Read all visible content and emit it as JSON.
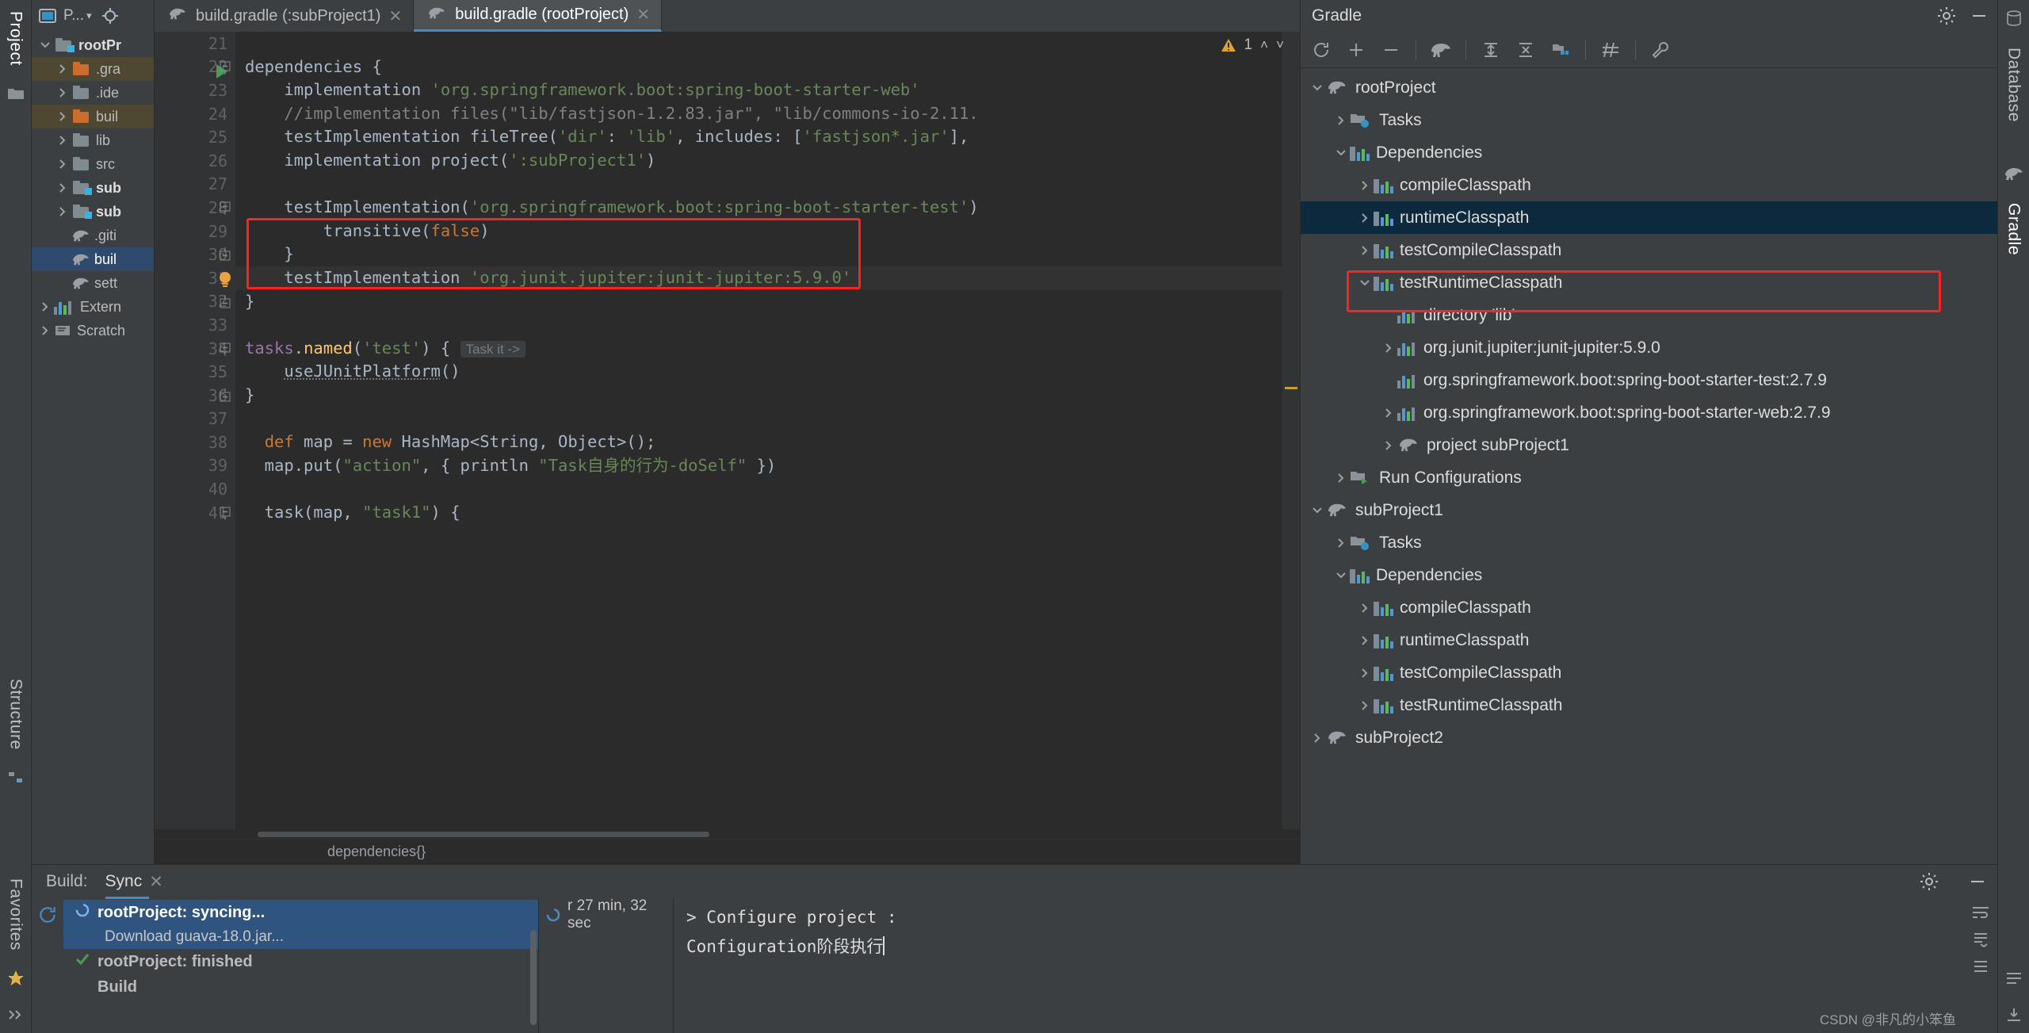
{
  "left_strip": {
    "project_tab": "Project",
    "structure_tab": "Structure",
    "favorites_tab": "Favorites",
    "folder_icon": "folder-icon",
    "star_icon": "star-icon",
    "expand_icon": "expand-chevrons-icon"
  },
  "right_strip": {
    "database_tab": "Database",
    "gradle_tab": "Gradle",
    "build_icon": "build-icon",
    "download_icon": "download-icon"
  },
  "project_panel": {
    "title": "P...",
    "dropdown_icon": "chevron-down-icon",
    "locate_icon": "target-icon",
    "items": [
      {
        "label": "rootPr",
        "depth": 0,
        "arrow": "chevron-down",
        "icon": "module-folder-icon",
        "bold": true,
        "state": "normal"
      },
      {
        "label": ".gra",
        "depth": 1,
        "arrow": "chevron-right",
        "icon": "excluded-folder-icon",
        "bold": false,
        "state": "excluded"
      },
      {
        "label": ".ide",
        "depth": 1,
        "arrow": "chevron-right",
        "icon": "folder-icon",
        "bold": false,
        "state": "normal"
      },
      {
        "label": "buil",
        "depth": 1,
        "arrow": "chevron-right",
        "icon": "excluded-folder-icon",
        "bold": false,
        "state": "excluded"
      },
      {
        "label": "lib",
        "depth": 1,
        "arrow": "chevron-right",
        "icon": "folder-icon",
        "bold": false,
        "state": "normal"
      },
      {
        "label": "src",
        "depth": 1,
        "arrow": "chevron-right",
        "icon": "folder-icon",
        "bold": false,
        "state": "normal"
      },
      {
        "label": "sub",
        "depth": 1,
        "arrow": "chevron-right",
        "icon": "module-folder-icon",
        "bold": true,
        "state": "normal"
      },
      {
        "label": "sub",
        "depth": 1,
        "arrow": "chevron-right",
        "icon": "module-folder-icon",
        "bold": true,
        "state": "normal"
      },
      {
        "label": ".giti",
        "depth": 1,
        "arrow": "none",
        "icon": "gradle-file-icon",
        "bold": false,
        "state": "normal"
      },
      {
        "label": "buil",
        "depth": 1,
        "arrow": "none",
        "icon": "gradle-file-icon",
        "bold": false,
        "state": "selected"
      },
      {
        "label": "sett",
        "depth": 1,
        "arrow": "none",
        "icon": "gradle-file-icon",
        "bold": false,
        "state": "normal"
      },
      {
        "label": "Extern",
        "depth": 0,
        "arrow": "chevron-right",
        "icon": "library-icon",
        "bold": false,
        "state": "normal"
      },
      {
        "label": "Scratch",
        "depth": 0,
        "arrow": "chevron-right",
        "icon": "scratch-icon",
        "bold": false,
        "state": "normal"
      }
    ]
  },
  "editor": {
    "tabs": [
      {
        "label": "build.gradle (:subProject1)",
        "icon": "gradle-elephant-icon",
        "active": false,
        "close_icon": "close-icon"
      },
      {
        "label": "build.gradle (rootProject)",
        "icon": "gradle-elephant-icon",
        "active": true,
        "close_icon": "close-icon"
      }
    ],
    "warning_count": "1",
    "warning_icon": "warning-triangle-icon",
    "prev_icon": "chevron-up-icon",
    "next_icon": "chevron-down-icon",
    "breadcrumb": "dependencies{}",
    "first_line_number": 21,
    "lines": [
      {
        "n": 21,
        "text": ""
      },
      {
        "n": 22,
        "text": "dependencies {",
        "run_marker": true,
        "fold": "minus"
      },
      {
        "n": 23,
        "text": "    implementation 'org.springframework.boot:spring-boot-starter-web'"
      },
      {
        "n": 24,
        "text": "    //implementation files(\"lib/fastjson-1.2.83.jar\", \"lib/commons-io-2.11."
      },
      {
        "n": 25,
        "text": "    testImplementation fileTree('dir': 'lib', includes: ['fastjson*.jar'],"
      },
      {
        "n": 26,
        "text": "    implementation project(':subProject1')"
      },
      {
        "n": 27,
        "text": ""
      },
      {
        "n": 28,
        "text": "    testImplementation('org.springframework.boot:spring-boot-starter-test')",
        "fold": "minus"
      },
      {
        "n": 29,
        "text": "        transitive(false)"
      },
      {
        "n": 30,
        "text": "    }",
        "fold": "end"
      },
      {
        "n": 31,
        "text": "    testImplementation 'org.junit.jupiter:junit-jupiter:5.9.0'",
        "bulb": true,
        "current": true
      },
      {
        "n": 32,
        "text": "}",
        "fold": "end"
      },
      {
        "n": 33,
        "text": ""
      },
      {
        "n": 34,
        "text": "tasks.named('test') { Task it ->",
        "fold": "minus",
        "hint": "Task it ->"
      },
      {
        "n": 35,
        "text": "    useJUnitPlatform()"
      },
      {
        "n": 36,
        "text": "}",
        "fold": "end"
      },
      {
        "n": 37,
        "text": ""
      },
      {
        "n": 38,
        "text": "  def map = new HashMap<String, Object>();"
      },
      {
        "n": 39,
        "text": "  map.put(\"action\", { println \"Task自身的行为-doSelf\" })"
      },
      {
        "n": 40,
        "text": ""
      },
      {
        "n": 41,
        "text": "  task(map, \"task1\") {",
        "fold": "minus"
      }
    ]
  },
  "gradle_panel": {
    "title": "Gradle",
    "settings_icon": "gear-icon",
    "minimize_icon": "minimize-icon",
    "toolbar": [
      {
        "name": "refresh-icon",
        "label": "Reload All Gradle Projects"
      },
      {
        "name": "plus-icon",
        "label": "Link Gradle Project"
      },
      {
        "name": "minus-icon",
        "label": "Detach External Project"
      },
      {
        "name": "elephant-icon",
        "label": "Execute Gradle Task"
      },
      {
        "name": "expand-all-icon",
        "label": "Expand All"
      },
      {
        "name": "collapse-all-icon",
        "label": "Collapse All"
      },
      {
        "name": "module-icon",
        "label": "Show Modules"
      },
      {
        "name": "skip-tests-icon",
        "label": "Toggle Offline Mode"
      },
      {
        "name": "wrench-icon",
        "label": "Build Tool Settings"
      }
    ],
    "tree": [
      {
        "label": "rootProject",
        "depth": 0,
        "arrow": "chevron-down",
        "icon": "elephant-icon"
      },
      {
        "label": "Tasks",
        "depth": 1,
        "arrow": "chevron-right",
        "icon": "tasks-icon"
      },
      {
        "label": "Dependencies",
        "depth": 1,
        "arrow": "chevron-down",
        "icon": "dependencies-icon"
      },
      {
        "label": "compileClasspath",
        "depth": 2,
        "arrow": "chevron-right",
        "icon": "dependencies-icon"
      },
      {
        "label": "runtimeClasspath",
        "depth": 2,
        "arrow": "chevron-right",
        "icon": "dependencies-icon",
        "selected": true
      },
      {
        "label": "testCompileClasspath",
        "depth": 2,
        "arrow": "chevron-right",
        "icon": "dependencies-icon"
      },
      {
        "label": "testRuntimeClasspath",
        "depth": 2,
        "arrow": "chevron-down",
        "icon": "dependencies-icon"
      },
      {
        "label": "directory 'lib'",
        "depth": 3,
        "arrow": "none",
        "icon": "library-bars-icon"
      },
      {
        "label": "org.junit.jupiter:junit-jupiter:5.9.0",
        "depth": 3,
        "arrow": "chevron-right",
        "icon": "library-bars-icon",
        "highlight": true
      },
      {
        "label": "org.springframework.boot:spring-boot-starter-test:2.7.9",
        "depth": 3,
        "arrow": "none",
        "icon": "library-bars-icon",
        "highlight": true
      },
      {
        "label": "org.springframework.boot:spring-boot-starter-web:2.7.9",
        "depth": 3,
        "arrow": "chevron-right",
        "icon": "library-bars-icon"
      },
      {
        "label": "project subProject1",
        "depth": 3,
        "arrow": "chevron-right",
        "icon": "elephant-icon"
      },
      {
        "label": "Run Configurations",
        "depth": 1,
        "arrow": "chevron-right",
        "icon": "run-config-icon"
      },
      {
        "label": "subProject1",
        "depth": 0,
        "arrow": "chevron-down",
        "icon": "elephant-icon"
      },
      {
        "label": "Tasks",
        "depth": 1,
        "arrow": "chevron-right",
        "icon": "tasks-icon"
      },
      {
        "label": "Dependencies",
        "depth": 1,
        "arrow": "chevron-down",
        "icon": "dependencies-icon"
      },
      {
        "label": "compileClasspath",
        "depth": 2,
        "arrow": "chevron-right",
        "icon": "dependencies-icon"
      },
      {
        "label": "runtimeClasspath",
        "depth": 2,
        "arrow": "chevron-right",
        "icon": "dependencies-icon"
      },
      {
        "label": "testCompileClasspath",
        "depth": 2,
        "arrow": "chevron-right",
        "icon": "dependencies-icon"
      },
      {
        "label": "testRuntimeClasspath",
        "depth": 2,
        "arrow": "chevron-right",
        "icon": "dependencies-icon"
      },
      {
        "label": "subProject2",
        "depth": 0,
        "arrow": "chevron-right",
        "icon": "elephant-icon"
      }
    ]
  },
  "build_panel": {
    "title": "Build:",
    "sync_tab": "Sync",
    "sync_close_icon": "close-icon",
    "settings_icon": "gear-icon",
    "minimize_icon": "minimize-icon",
    "rerun_icon": "rerun-icon",
    "tree": [
      {
        "label": "rootProject: syncing...",
        "icon": "spinner-icon",
        "selected": true
      },
      {
        "label": "Download guava-18.0.jar...",
        "icon": "none",
        "sub": true
      },
      {
        "label": "rootProject: finished",
        "icon": "check-icon",
        "selected": false
      },
      {
        "label": "Build",
        "icon": "none",
        "sub": false
      }
    ],
    "duration": "r 27 min, 32 sec",
    "duration_icon": "spinner-icon",
    "console": [
      "> Configure project :",
      "Configuration阶段执行"
    ],
    "right_icons": [
      "wrap-text-icon",
      "scroll-to-end-icon",
      "soft-wrap-icon"
    ],
    "watermark": "CSDN @非凡的小笨鱼"
  },
  "colors": {
    "accent_blue": "#4a88c7",
    "selection_blue": "#0d293e",
    "highlight_red": "#ff2020",
    "warning_yellow": "#c5a22c",
    "string_green": "#6a8759",
    "keyword_orange": "#cc7832",
    "bg_editor": "#2b2b2b",
    "bg_panel": "#3c3f41"
  }
}
